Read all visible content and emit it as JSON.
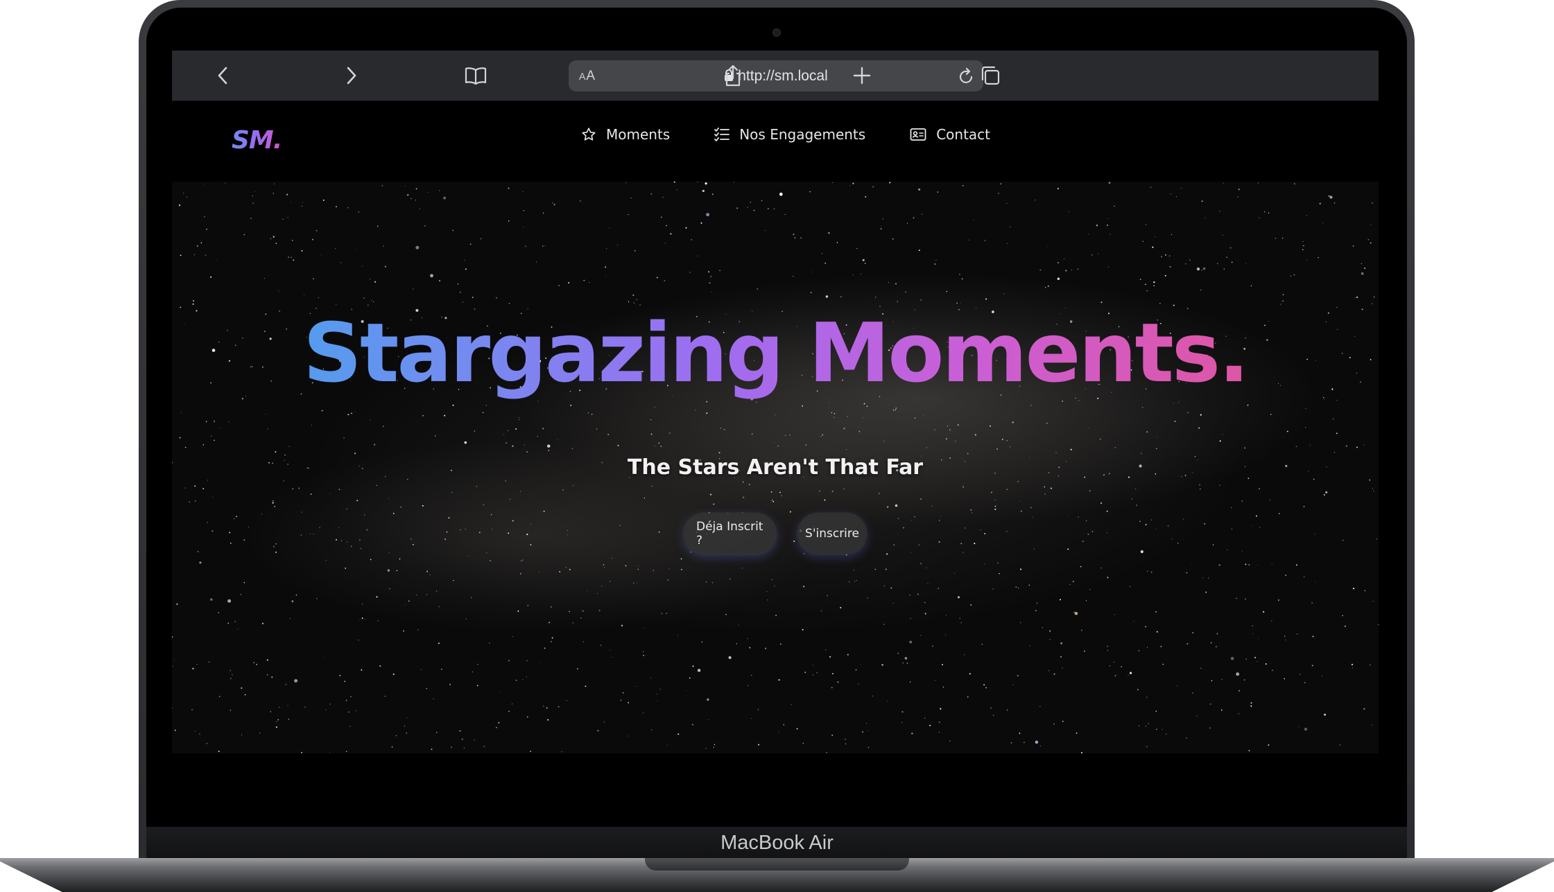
{
  "device": {
    "label": "MacBook Air"
  },
  "browser": {
    "reader_label_small": "A",
    "reader_label_large": "A",
    "url": "http://sm.local",
    "icons": [
      "back-icon",
      "forward-icon",
      "bookmarks-icon",
      "lock-icon",
      "reload-icon",
      "share-icon",
      "new-tab-icon",
      "tabs-icon"
    ]
  },
  "site": {
    "logo": "SM.",
    "nav": [
      {
        "label": "Moments",
        "icon": "star-icon"
      },
      {
        "label": "Nos Engagements",
        "icon": "checklist-icon"
      },
      {
        "label": "Contact",
        "icon": "contact-card-icon"
      }
    ],
    "hero": {
      "title": "Stargazing Moments.",
      "subtitle": "The Stars Aren't That Far",
      "buttons": [
        {
          "label": "Déja Inscrit ?"
        },
        {
          "label": "S'inscrire"
        }
      ]
    }
  },
  "colors": {
    "gradient_start": "#3aa9ec",
    "gradient_mid": "#9f6df0",
    "gradient_end": "#ef4f83",
    "toolbar": "#282a2d",
    "address_bar": "#444649"
  }
}
